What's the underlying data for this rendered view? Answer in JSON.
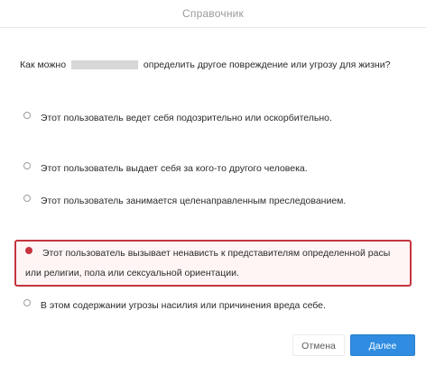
{
  "dialog": {
    "title": "Справочник",
    "question": {
      "before": "Как можно",
      "after": "определить другое повреждение или угрозу для жизни?"
    },
    "options": [
      {
        "label": "Этот пользователь ведет себя подозрительно или оскорбительно."
      },
      {
        "label": "Этот пользователь выдает себя за кого-то другого человека."
      },
      {
        "label": "Этот пользователь занимается целенаправленным преследованием."
      },
      {
        "label": "Этот пользователь вызывает ненависть к представителям определенной расы или религии, пола или сексуальной ориентации.",
        "selected": true
      },
      {
        "label": "В этом содержании угрозы насилия или причинения вреда себе."
      }
    ],
    "buttons": {
      "cancel": "Отмена",
      "confirm": "Далее"
    }
  },
  "colors": {
    "accent": "#2f8ce0",
    "highlight": "#c6343e"
  }
}
